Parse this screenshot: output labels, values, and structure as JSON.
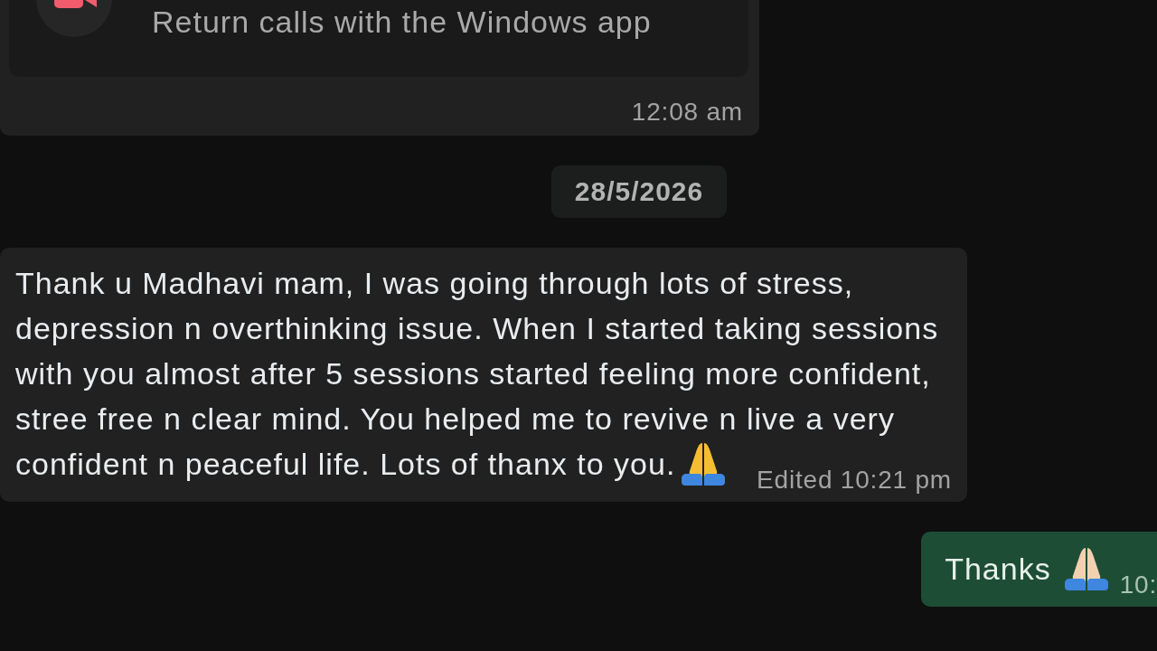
{
  "chat": {
    "messages": [
      {
        "kind": "call_notice",
        "outgoing": false,
        "notice": "Return calls with the Windows app",
        "time": "12:08 am"
      },
      {
        "kind": "date",
        "label": "28/5/2026"
      },
      {
        "kind": "text",
        "outgoing": false,
        "lines": [
          "Thank u Madhavi mam, I was going through lots of stress,",
          "depression n overthinking issue. When I started taking sessions",
          "with you almost after 5 sessions started feeling more confident,",
          "stree free n clear mind. You helped me to revive n live a very",
          "confident n peaceful life. Lots of thanx to you."
        ],
        "time": "Edited 10:21 pm"
      },
      {
        "kind": "text",
        "outgoing": true,
        "lines": [
          "Thanks"
        ],
        "time": "10:"
      }
    ]
  }
}
